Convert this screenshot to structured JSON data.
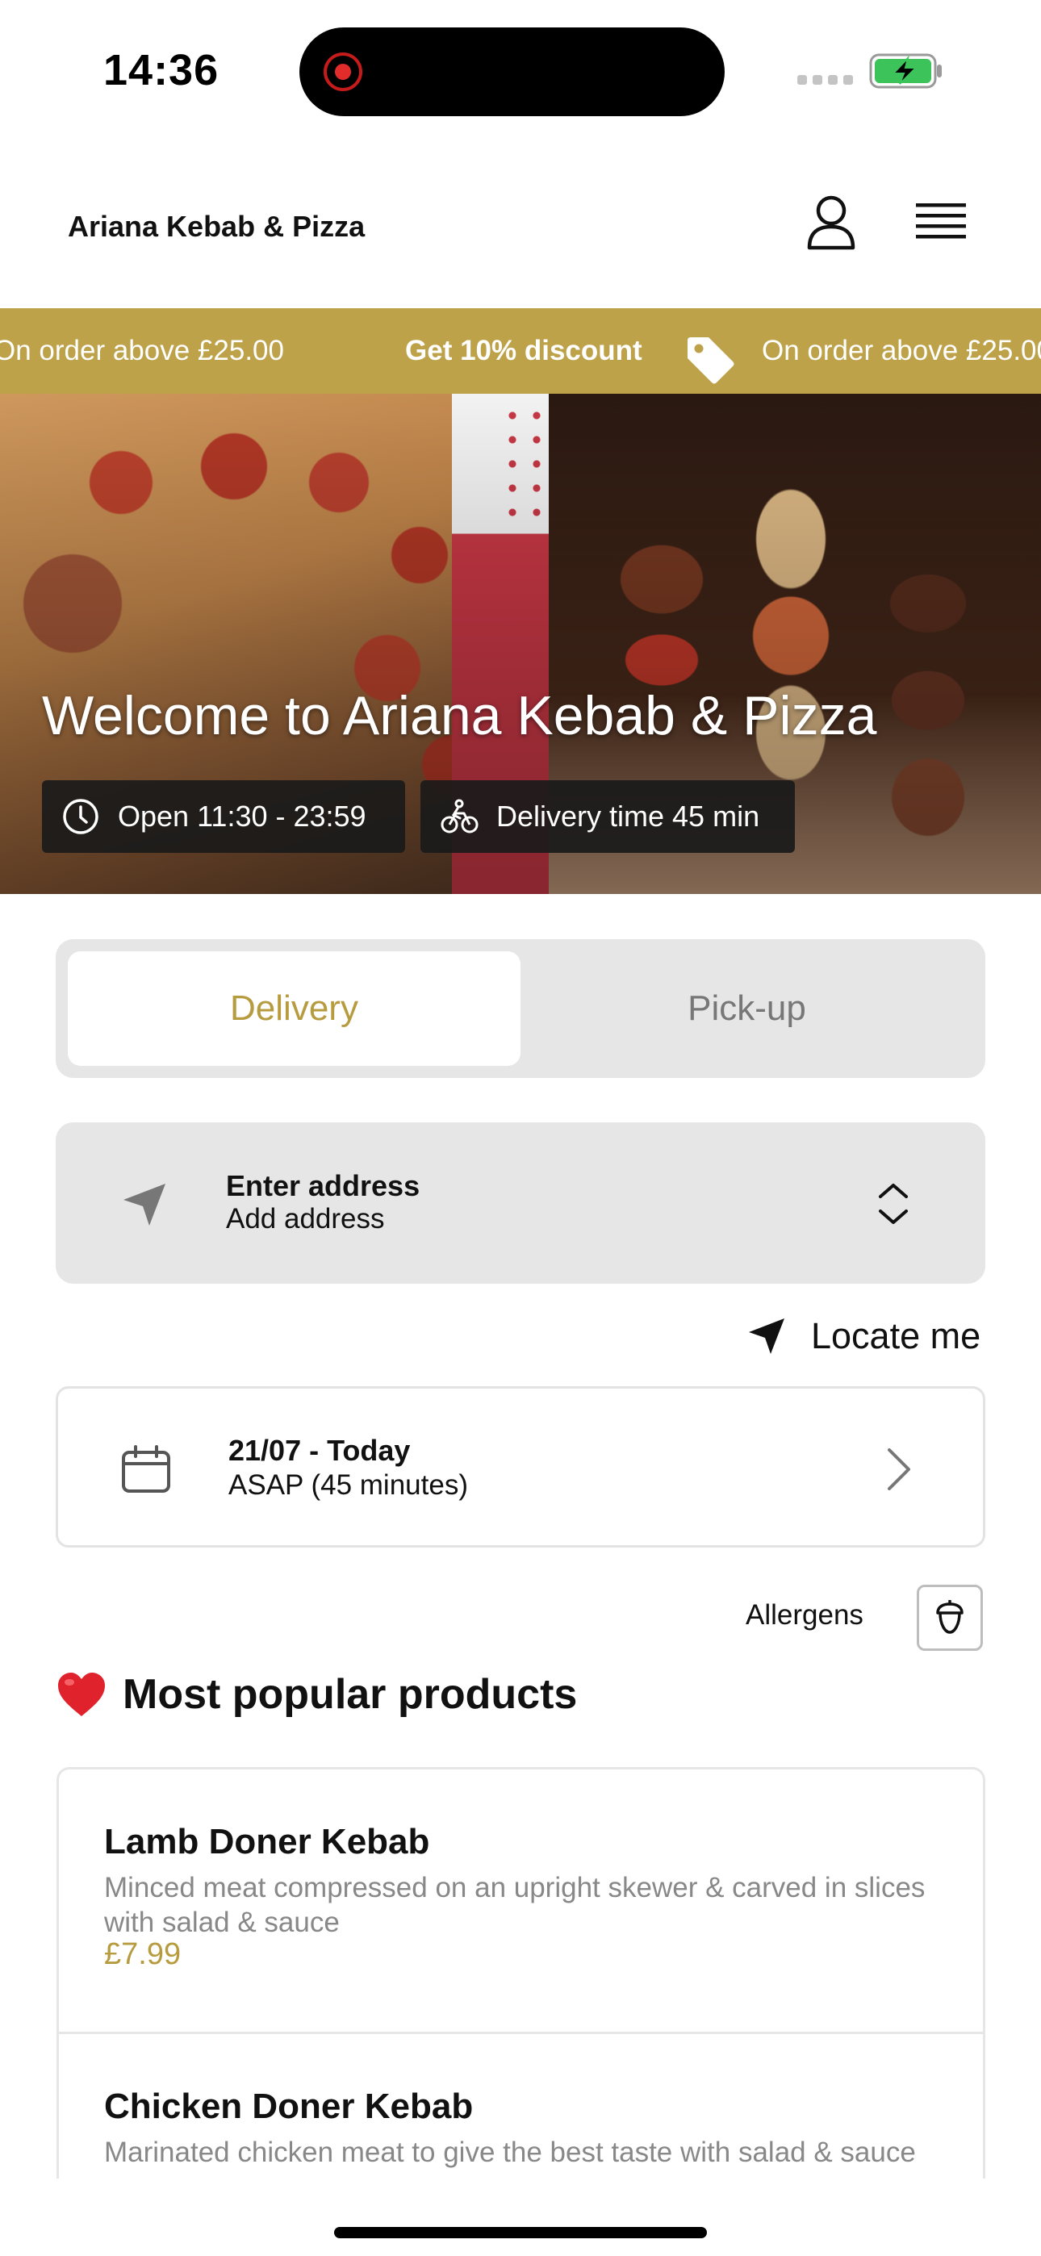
{
  "status_bar": {
    "time": "14:36"
  },
  "header": {
    "title": "Ariana Kebab & Pizza"
  },
  "promo": {
    "left_text": "On order above £25.00",
    "center_text": "Get 10% discount",
    "right_text": "On order above £25.00"
  },
  "hero": {
    "title": "Welcome to Ariana Kebab & Pizza",
    "open_hours": "Open 11:30 - 23:59",
    "delivery_time": "Delivery time 45 min"
  },
  "tabs": [
    {
      "label": "Delivery",
      "active": true
    },
    {
      "label": "Pick-up",
      "active": false
    }
  ],
  "address": {
    "title": "Enter address",
    "subtitle": "Add address"
  },
  "locate": {
    "label": "Locate me"
  },
  "date": {
    "title": "21/07 - Today",
    "subtitle": "ASAP (45 minutes)"
  },
  "allergens": {
    "label": "Allergens"
  },
  "section": {
    "title": "Most popular products"
  },
  "products": [
    {
      "name": "Lamb Doner Kebab",
      "description": "Minced meat compressed on an upright skewer & carved in slices with salad & sauce",
      "price": "£7.99"
    },
    {
      "name": "Chicken Doner Kebab",
      "description": "Marinated chicken meat to give the best taste with salad & sauce",
      "price": ""
    }
  ],
  "colors": {
    "accent": "#b79b3f",
    "promo_bg": "#bda24a",
    "tab_bg": "#e6e6e6"
  }
}
